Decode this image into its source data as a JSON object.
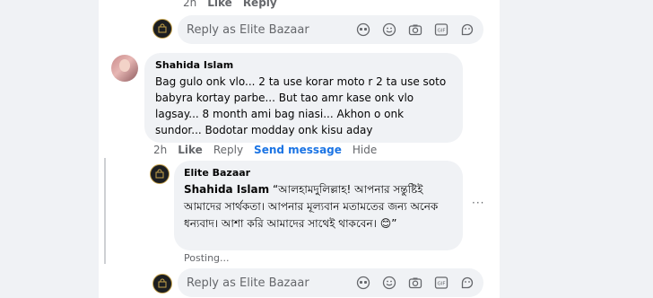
{
  "top_meta": {
    "time": "2h",
    "like": "Like",
    "reply": "Reply"
  },
  "reply_box": {
    "placeholder": "Reply as Elite Bazaar"
  },
  "comment": {
    "author": "Shahida Islam",
    "text": "Bag gulo onk vlo... 2 ta use korar moto r 2 ta use soto babyra kortay parbe... But tao amr kase onk vlo lagsay... 8 month ami bag niasi... Akhon o onk sundor... Bodotar modday onk kisu aday",
    "meta": {
      "time": "2h",
      "like": "Like",
      "reply": "Reply",
      "send": "Send message",
      "hide": "Hide"
    }
  },
  "page_reply": {
    "author": "Elite Bazaar",
    "mention": "Shahida Islam",
    "text": " “আলহামদুলিল্লাহ! আপনার সন্তুষ্টিই আমাদের সার্থকতা। আপনার মূল্যবান মতামতের জন্য অনেক ধন্যবাদ। আশা করি আমাদের সাথেই থাকবেন। 😊”",
    "status": "Posting..."
  },
  "more_label": "···",
  "icons": [
    "avatar-sticker-icon",
    "emoji-icon",
    "camera-icon",
    "gif-icon",
    "sticker-icon"
  ]
}
